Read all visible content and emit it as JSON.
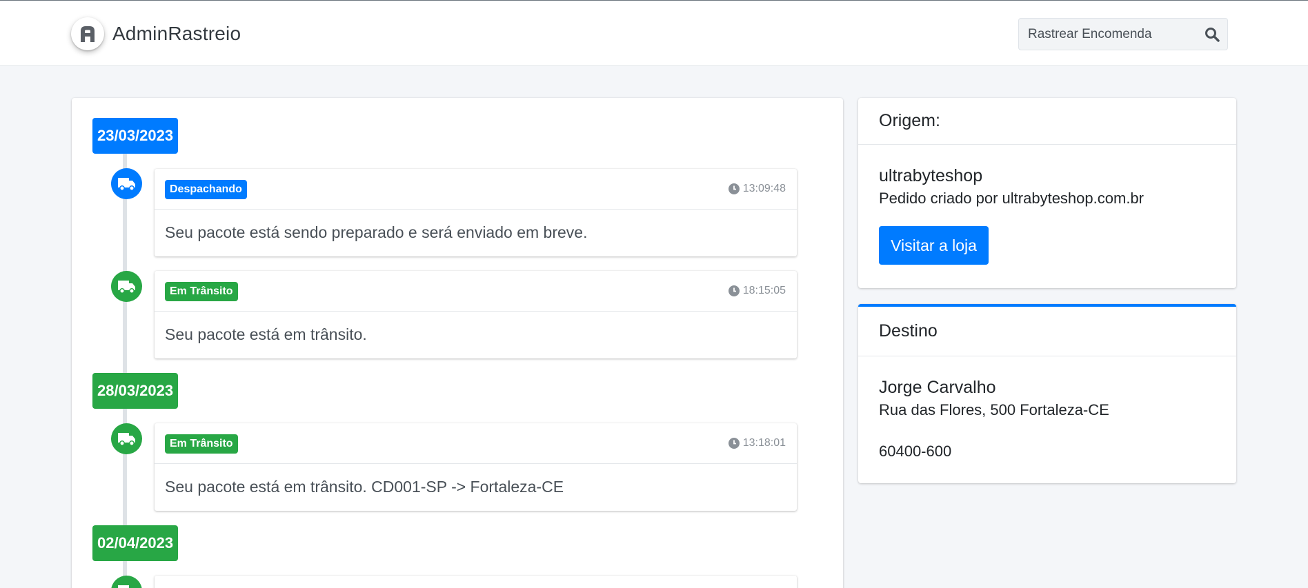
{
  "navbar": {
    "brand": "AdminRastreio",
    "logo_icon": "admin-logo-icon",
    "search_placeholder": "Rastrear Encomenda",
    "search_icon": "search-icon"
  },
  "colors": {
    "primary": "#007bff",
    "success": "#28a745",
    "background": "#f4f6f9"
  },
  "timeline": {
    "groups": [
      {
        "date": "23/03/2023",
        "color": "#007bff",
        "events": [
          {
            "status": "Despachando",
            "status_color": "#007bff",
            "time": "13:09:48",
            "message": "Seu pacote está sendo preparado e será enviado em breve.",
            "icon": "truck-icon"
          },
          {
            "status": "Em Trânsito",
            "status_color": "#28a745",
            "time": "18:15:05",
            "message": "Seu pacote está em trânsito.",
            "icon": "truck-icon"
          }
        ]
      },
      {
        "date": "28/03/2023",
        "color": "#28a745",
        "events": [
          {
            "status": "Em Trânsito",
            "status_color": "#28a745",
            "time": "13:18:01",
            "message": "Seu pacote está em trânsito. CD001-SP -> Fortaleza-CE",
            "icon": "truck-icon"
          }
        ]
      },
      {
        "date": "02/04/2023",
        "color": "#28a745",
        "events": []
      }
    ]
  },
  "origin": {
    "title": "Origem:",
    "store": "ultrabyteshop",
    "created_by": "Pedido criado por ultrabyteshop.com.br",
    "visit_button": "Visitar a loja"
  },
  "destination": {
    "title": "Destino",
    "name": "Jorge Carvalho",
    "address": "Rua das Flores, 500 Fortaleza-CE",
    "zip": "60400-600"
  }
}
